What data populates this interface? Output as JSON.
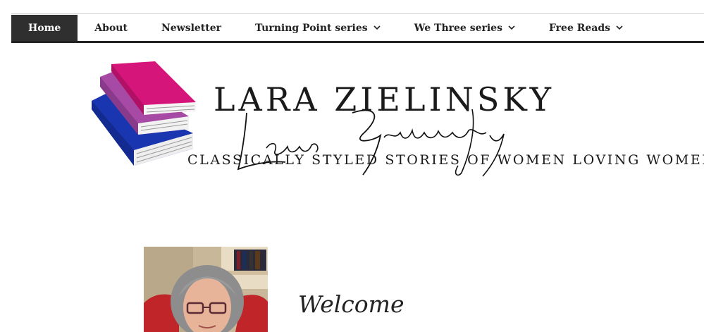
{
  "nav": {
    "items": [
      {
        "label": "Home",
        "active": true,
        "has_dropdown": false
      },
      {
        "label": "About",
        "active": false,
        "has_dropdown": false
      },
      {
        "label": "Newsletter",
        "active": false,
        "has_dropdown": false
      },
      {
        "label": "Turning Point series",
        "active": false,
        "has_dropdown": true
      },
      {
        "label": "We Three series",
        "active": false,
        "has_dropdown": true
      },
      {
        "label": "Free Reads",
        "active": false,
        "has_dropdown": true
      }
    ],
    "dropdown_icon": "chevron-down-icon"
  },
  "header": {
    "title": "LARA ZIELINSKY",
    "signature": "Lara Zielinsky",
    "tagline": "CLASSICALLY STYLED STORIES OF WOMEN LOVING WOMEN",
    "logo_icon": "stacked-books-logo",
    "colors": {
      "book_top": "#d6157a",
      "book_middle": "#a64aa6",
      "book_bottom": "#1a35b0"
    }
  },
  "main": {
    "heading": "Welcome",
    "photo": "author-portrait"
  }
}
